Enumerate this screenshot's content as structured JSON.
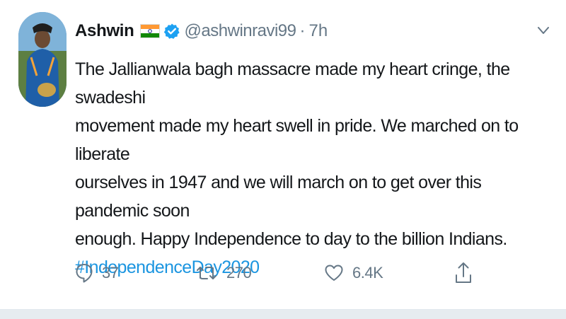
{
  "tweet": {
    "display_name": "Ashwin",
    "flag_icon": "india-flag-icon",
    "verified_icon": "verified-badge-icon",
    "handle": "@ashwinravi99",
    "separator": "·",
    "time": "7h",
    "body_lines": [
      "The Jallianwala bagh massacre made my heart cringe, the swadeshi",
      "movement made my heart swell in pride. We marched on to liberate",
      "ourselves in 1947 and we will march on to get over this pandemic soon",
      "enough. Happy Independence to day to the billion Indians."
    ],
    "hashtag": "#IndependenceDay2020"
  },
  "actions": {
    "reply": {
      "icon": "reply-icon",
      "count": "37"
    },
    "retweet": {
      "icon": "retweet-icon",
      "count": "270"
    },
    "like": {
      "icon": "heart-icon",
      "count": "6.4K"
    },
    "share": {
      "icon": "share-icon"
    }
  },
  "colors": {
    "text": "#14171a",
    "secondary": "#657786",
    "link": "#1b95e0",
    "verified": "#1da1f2"
  }
}
